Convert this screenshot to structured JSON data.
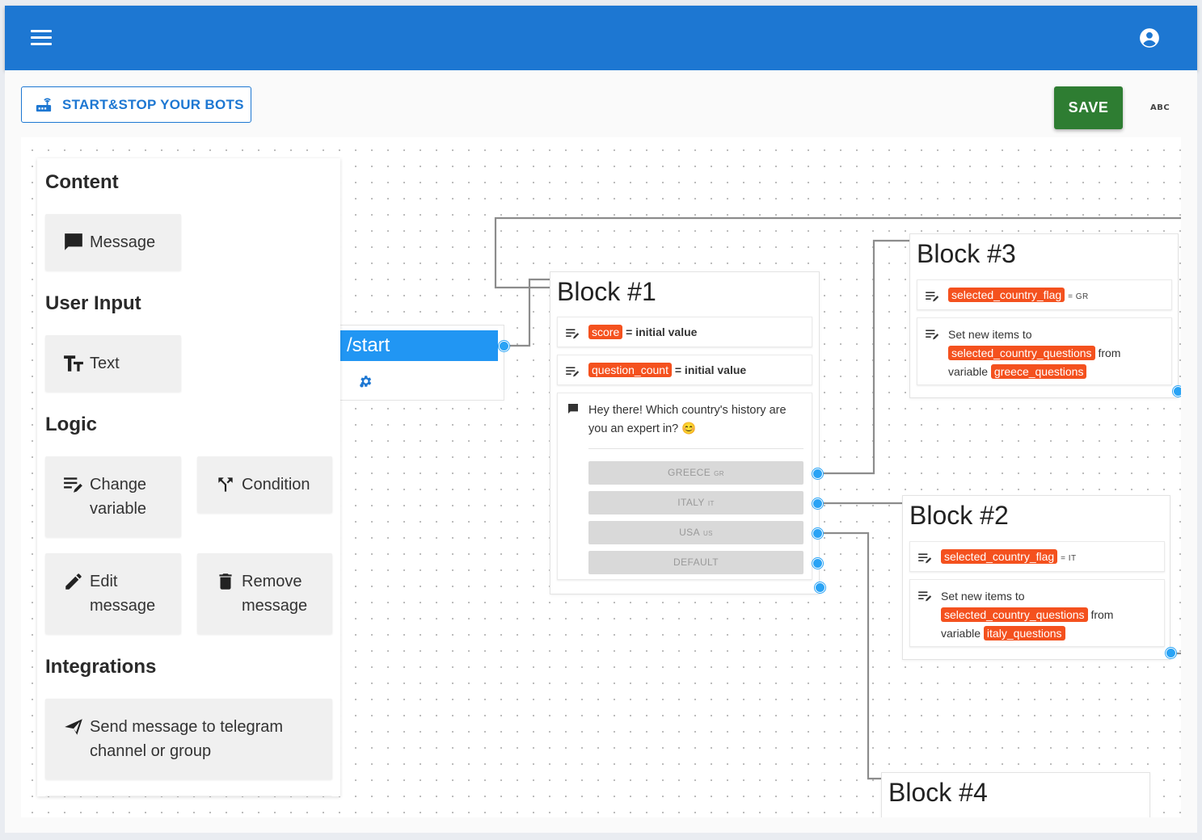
{
  "header": {
    "menu_icon": "menu-icon",
    "account_icon": "account-circle-icon",
    "color": "#1d77d2"
  },
  "toolbar": {
    "start_stop_label": "START&STOP YOUR BOTS",
    "save_label": "SAVE",
    "abc_label": "ABC"
  },
  "palette": {
    "content_heading": "Content",
    "message_label": "Message",
    "user_input_heading": "User Input",
    "text_label": "Text",
    "logic_heading": "Logic",
    "change_variable_line1": "Change",
    "change_variable_line2": "variable",
    "condition_label": "Condition",
    "edit_message_line1": "Edit",
    "edit_message_line2": "message",
    "remove_message_line1": "Remove",
    "remove_message_line2": "message",
    "integrations_heading": "Integrations",
    "send_telegram_line1": "Send message to telegram",
    "send_telegram_line2": "channel or group"
  },
  "start_node": {
    "command": "/start"
  },
  "block1": {
    "title": "Block #1",
    "score_var": "score",
    "score_assign": "= initial value",
    "question_count_var": "question_count",
    "question_count_assign": "= initial value",
    "message_line1": "Hey there! Which country's history are",
    "message_line2": "you an expert in? 😊",
    "choices": [
      {
        "label": "GREECE",
        "flag": "GR"
      },
      {
        "label": "ITALY",
        "flag": "IT"
      },
      {
        "label": "USA",
        "flag": "US"
      },
      {
        "label": "DEFAULT",
        "flag": ""
      }
    ]
  },
  "block3": {
    "title": "Block #3",
    "flag_var": "selected_country_flag",
    "flag_value": "= GR",
    "set_items_label": "Set new items to",
    "target_var": "selected_country_questions",
    "from_label": "from",
    "variable_label": "variable",
    "source_var": "greece_questions"
  },
  "block2": {
    "title": "Block #2",
    "flag_var": "selected_country_flag",
    "flag_value": "= IT",
    "set_items_label": "Set new items to",
    "target_var": "selected_country_questions",
    "from_label": "from",
    "variable_label": "variable",
    "source_var": "italy_questions"
  },
  "block4": {
    "title": "Block #4"
  },
  "colors": {
    "save": "#2e7d32",
    "variable_chip": "#f4511e",
    "port": "#29a3f5",
    "start_bar": "#2196f3"
  }
}
